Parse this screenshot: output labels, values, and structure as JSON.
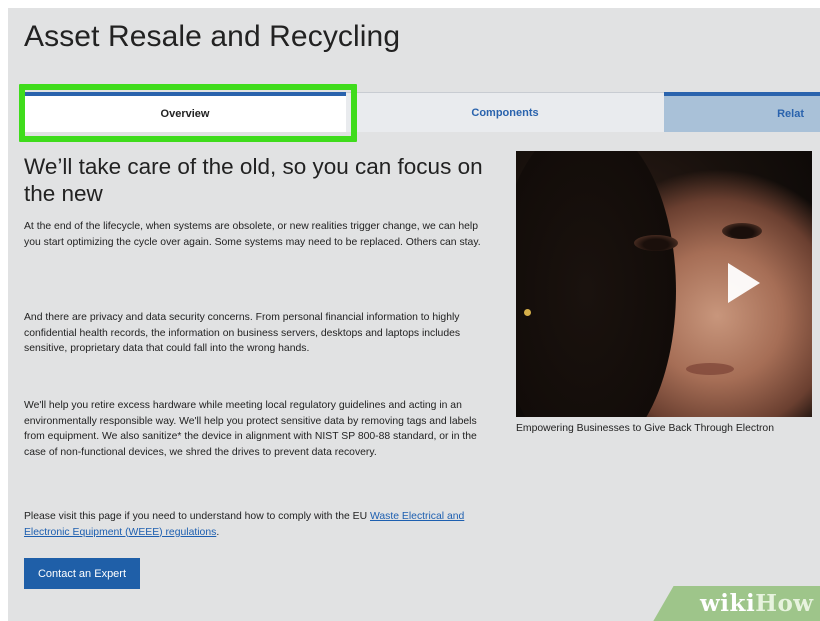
{
  "page": {
    "title": "Asset Resale and Recycling"
  },
  "tabs": [
    {
      "label": "Overview",
      "active": true
    },
    {
      "label": "Components",
      "active": false
    },
    {
      "label": "Relat",
      "active": false
    }
  ],
  "main": {
    "headline": "We’ll take care of the old, so you can focus on the new",
    "paragraphs": [
      "At the end of the lifecycle, when systems are obsolete, or new realities trigger change, we can help you start optimizing the cycle over again. Some systems may need to be replaced. Others can stay.",
      "And there are privacy and data security concerns. From personal financial information to highly confidential health records, the information on business servers, desktops and laptops includes sensitive, proprietary data that could fall into the wrong hands.",
      "We'll help you retire excess hardware while meeting local regulatory guidelines and acting in an environmentally responsible way. We'll help you protect sensitive data by removing tags and labels from equipment. We also sanitize* the device in alignment with NIST SP 800-88 standard, or in the case of non-functional devices, we shred the drives to prevent data recovery."
    ],
    "weee": {
      "prefix": "Please visit this page if you need to understand how to comply with the EU ",
      "link": "Waste Electrical and Electronic Equipment (WEEE) regulations",
      "suffix": "."
    },
    "cta_label": "Contact an Expert"
  },
  "video": {
    "caption": "Empowering Businesses to Give Back Through Electron",
    "play_icon": "play-icon"
  },
  "watermark": {
    "wiki": "wiki",
    "how": "How",
    "color": "#9ec58a"
  },
  "colors": {
    "highlight": "#3fdc1c",
    "accent": "#2a63ad",
    "button": "#1f5fa8"
  }
}
